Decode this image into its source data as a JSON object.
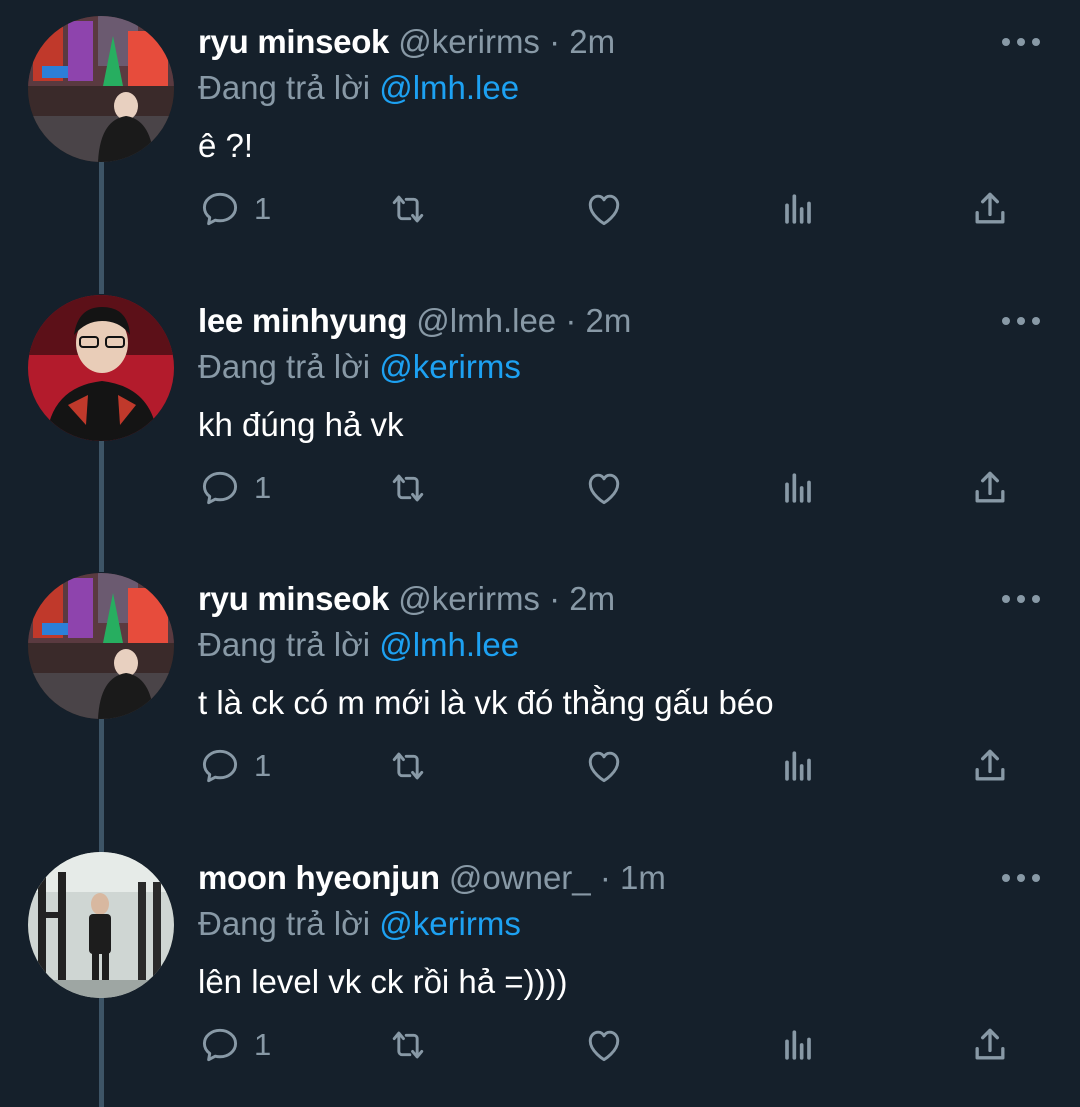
{
  "colors": {
    "background": "#15202b",
    "text_primary": "#ffffff",
    "text_secondary": "#8899a6",
    "mention": "#1da1f2",
    "thread_line": "#3d5466"
  },
  "icons": {
    "reply": "reply-bubble-icon",
    "retweet": "retweet-arrows-icon",
    "like": "heart-outline-icon",
    "stats": "analytics-bars-icon",
    "share": "share-upload-icon",
    "more": "ellipsis-icon"
  },
  "tweets": [
    {
      "name": "ryu minseok",
      "handle": "@kerirms",
      "dot": "·",
      "time": "2m",
      "reply_prefix": "Đang trả lời",
      "reply_mention": "@lmh.lee",
      "text": "ê ?!",
      "reply_count": "1"
    },
    {
      "name": "lee minhyung",
      "handle": "@lmh.lee",
      "dot": "·",
      "time": "2m",
      "reply_prefix": "Đang trả lời",
      "reply_mention": "@kerirms",
      "text": "kh đúng hả vk",
      "reply_count": "1"
    },
    {
      "name": "ryu minseok",
      "handle": "@kerirms",
      "dot": "·",
      "time": "2m",
      "reply_prefix": "Đang trả lời",
      "reply_mention": "@lmh.lee",
      "text": "t là ck có m mới là vk đó thằng gấu béo",
      "reply_count": "1"
    },
    {
      "name": "moon hyeonjun",
      "handle": "@owner_",
      "dot": "·",
      "time": "1m",
      "reply_prefix": "Đang trả lời",
      "reply_mention": "@kerirms",
      "text": "lên level vk ck rồi hả =))))",
      "reply_count": "1"
    }
  ]
}
